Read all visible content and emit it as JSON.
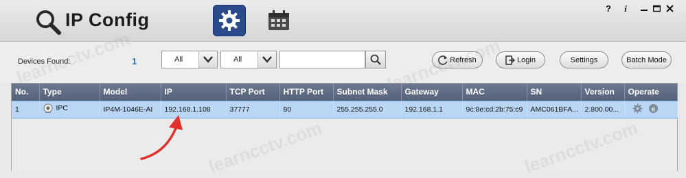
{
  "app": {
    "title": "IP Config"
  },
  "window_controls": {
    "help": "?",
    "info": "i"
  },
  "toolbar": {
    "devices_found_label": "Devices Found:",
    "devices_found_count": "1",
    "filter1_value": "All",
    "filter2_value": "All",
    "search_value": "",
    "refresh_label": "Refresh",
    "login_label": "Login",
    "settings_label": "Settings",
    "batch_mode_label": "Batch Mode"
  },
  "table": {
    "headers": [
      "No.",
      "Type",
      "Model",
      "IP",
      "TCP Port",
      "HTTP Port",
      "Subnet Mask",
      "Gateway",
      "MAC",
      "SN",
      "Version",
      "Operate"
    ],
    "rows": [
      {
        "no": "1",
        "type": "IPC",
        "model": "IP4M-1046E-AI",
        "ip": "192.168.1.108",
        "tcp_port": "37777",
        "http_port": "80",
        "subnet_mask": "255.255.255.0",
        "gateway": "192.168.1.1",
        "mac": "9c:8e:cd:2b:75:c9",
        "sn": "AMC061BFA...",
        "version": "2.800.00..."
      }
    ]
  },
  "watermark": "learncctv.com",
  "colors": {
    "accent": "#2b4a8b",
    "selection": "#b9d7f4",
    "header": "#606c84",
    "annotation_arrow": "#e0312c"
  },
  "icons": [
    "search-icon",
    "gear-icon",
    "calendar-icon",
    "help-icon",
    "info-icon",
    "minimize-icon",
    "maximize-icon",
    "close-icon",
    "chevron-down-icon",
    "refresh-icon",
    "login-icon",
    "camera-icon",
    "settings-gear-icon",
    "browser-e-icon"
  ]
}
